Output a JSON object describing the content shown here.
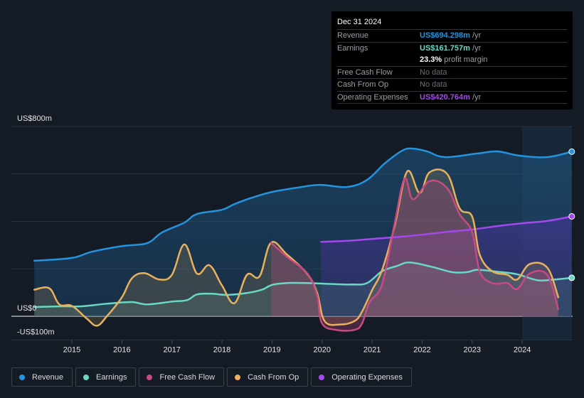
{
  "tooltip": {
    "date": "Dec 31 2024",
    "rows": [
      {
        "label": "Revenue",
        "value": "US$694.298m",
        "unit": "/yr",
        "color": "#2394df"
      },
      {
        "label": "Earnings",
        "value": "US$161.757m",
        "unit": "/yr",
        "color": "#6ad8c5"
      },
      {
        "label": "",
        "value": "23.3%",
        "unit": "profit margin",
        "color": "#ffffff"
      },
      {
        "label": "Free Cash Flow",
        "value": "No data",
        "unit": "",
        "color": "#6b7075"
      },
      {
        "label": "Cash From Op",
        "value": "No data",
        "unit": "",
        "color": "#6b7075"
      },
      {
        "label": "Operating Expenses",
        "value": "US$420.764m",
        "unit": "/yr",
        "color": "#a548ef"
      }
    ]
  },
  "legend": [
    {
      "label": "Revenue",
      "color": "#2394df"
    },
    {
      "label": "Earnings",
      "color": "#6ad8c5"
    },
    {
      "label": "Free Cash Flow",
      "color": "#c94a83"
    },
    {
      "label": "Cash From Op",
      "color": "#e9b15c"
    },
    {
      "label": "Operating Expenses",
      "color": "#a548ef"
    }
  ],
  "chart_data": {
    "type": "area",
    "title": "",
    "xlabel": "",
    "ylabel": "",
    "ylim": [
      -100,
      800
    ],
    "xlim": [
      2014.25,
      2024.99
    ],
    "y_tick_labels": [
      {
        "value": 800,
        "label": "US$800m"
      },
      {
        "value": 0,
        "label": "US$0"
      },
      {
        "value": -100,
        "label": "-US$100m"
      }
    ],
    "gridlines_y": [
      800,
      600,
      400,
      200,
      0,
      -100
    ],
    "x_ticks": [
      2015,
      2016,
      2017,
      2018,
      2019,
      2020,
      2021,
      2022,
      2023,
      2024
    ],
    "highlight_region": {
      "from": 2024.0,
      "to": 2024.99
    },
    "grid": true,
    "legend_position": "bottom-left",
    "series": [
      {
        "name": "Revenue",
        "color": "#2394df",
        "points": [
          [
            2014.25,
            234
          ],
          [
            2015.0,
            246
          ],
          [
            2015.4,
            272
          ],
          [
            2016.0,
            296
          ],
          [
            2016.5,
            308
          ],
          [
            2016.8,
            353
          ],
          [
            2017.25,
            395
          ],
          [
            2017.5,
            431
          ],
          [
            2018.0,
            449
          ],
          [
            2018.25,
            473
          ],
          [
            2018.6,
            500
          ],
          [
            2019.0,
            524
          ],
          [
            2019.5,
            542
          ],
          [
            2019.95,
            554
          ],
          [
            2020.5,
            545
          ],
          [
            2020.9,
            575
          ],
          [
            2021.25,
            644
          ],
          [
            2021.6,
            698
          ],
          [
            2021.8,
            707
          ],
          [
            2022.1,
            695
          ],
          [
            2022.45,
            671
          ],
          [
            2023.1,
            686
          ],
          [
            2023.5,
            695
          ],
          [
            2023.95,
            677
          ],
          [
            2024.5,
            671
          ],
          [
            2024.99,
            694
          ]
        ]
      },
      {
        "name": "Operating Expenses",
        "color": "#a548ef",
        "points": [
          [
            2019.98,
            314
          ],
          [
            2020.5,
            318
          ],
          [
            2021.0,
            326
          ],
          [
            2021.5,
            334
          ],
          [
            2022.0,
            344
          ],
          [
            2022.5,
            356
          ],
          [
            2023.0,
            366
          ],
          [
            2023.5,
            380
          ],
          [
            2024.0,
            392
          ],
          [
            2024.5,
            402
          ],
          [
            2024.99,
            421
          ]
        ]
      },
      {
        "name": "Earnings",
        "color": "#6ad8c5",
        "points": [
          [
            2014.25,
            39
          ],
          [
            2014.8,
            42
          ],
          [
            2015.2,
            42
          ],
          [
            2015.7,
            53
          ],
          [
            2016.2,
            60
          ],
          [
            2016.5,
            50
          ],
          [
            2017.0,
            62
          ],
          [
            2017.3,
            68
          ],
          [
            2017.5,
            92
          ],
          [
            2017.8,
            95
          ],
          [
            2018.1,
            90
          ],
          [
            2018.5,
            98
          ],
          [
            2018.8,
            112
          ],
          [
            2019.0,
            132
          ],
          [
            2019.3,
            140
          ],
          [
            2019.7,
            140
          ],
          [
            2020.2,
            136
          ],
          [
            2020.6,
            134
          ],
          [
            2020.9,
            140
          ],
          [
            2021.2,
            190
          ],
          [
            2021.5,
            212
          ],
          [
            2021.75,
            227
          ],
          [
            2022.2,
            208
          ],
          [
            2022.6,
            186
          ],
          [
            2022.9,
            186
          ],
          [
            2023.1,
            196
          ],
          [
            2023.5,
            188
          ],
          [
            2023.9,
            177
          ],
          [
            2024.3,
            152
          ],
          [
            2024.6,
            154
          ],
          [
            2024.99,
            162
          ]
        ]
      },
      {
        "name": "Free Cash Flow",
        "color": "#c94a83",
        "points": [
          [
            2018.98,
            310
          ],
          [
            2019.3,
            250
          ],
          [
            2019.7,
            182
          ],
          [
            2019.9,
            90
          ],
          [
            2020.0,
            -30
          ],
          [
            2020.3,
            -58
          ],
          [
            2020.65,
            -57
          ],
          [
            2020.8,
            -30
          ],
          [
            2020.95,
            60
          ],
          [
            2021.2,
            135
          ],
          [
            2021.45,
            390
          ],
          [
            2021.65,
            580
          ],
          [
            2021.82,
            493
          ],
          [
            2022.15,
            570
          ],
          [
            2022.5,
            540
          ],
          [
            2022.75,
            430
          ],
          [
            2023.0,
            355
          ],
          [
            2023.15,
            190
          ],
          [
            2023.4,
            140
          ],
          [
            2023.7,
            140
          ],
          [
            2023.9,
            115
          ],
          [
            2024.15,
            180
          ],
          [
            2024.5,
            175
          ],
          [
            2024.72,
            30
          ]
        ]
      },
      {
        "name": "Cash From Op",
        "color": "#e9b15c",
        "points": [
          [
            2014.25,
            112
          ],
          [
            2014.55,
            118
          ],
          [
            2014.75,
            50
          ],
          [
            2015.0,
            44
          ],
          [
            2015.3,
            -10
          ],
          [
            2015.5,
            -40
          ],
          [
            2015.7,
            0
          ],
          [
            2016.0,
            80
          ],
          [
            2016.2,
            160
          ],
          [
            2016.45,
            182
          ],
          [
            2016.75,
            155
          ],
          [
            2017.0,
            175
          ],
          [
            2017.25,
            303
          ],
          [
            2017.5,
            180
          ],
          [
            2017.75,
            215
          ],
          [
            2018.0,
            130
          ],
          [
            2018.25,
            55
          ],
          [
            2018.5,
            175
          ],
          [
            2018.75,
            168
          ],
          [
            2018.98,
            310
          ],
          [
            2019.3,
            260
          ],
          [
            2019.7,
            180
          ],
          [
            2019.9,
            100
          ],
          [
            2020.05,
            -20
          ],
          [
            2020.35,
            -35
          ],
          [
            2020.65,
            -20
          ],
          [
            2020.8,
            20
          ],
          [
            2021.0,
            110
          ],
          [
            2021.2,
            195
          ],
          [
            2021.45,
            380
          ],
          [
            2021.7,
            610
          ],
          [
            2021.95,
            520
          ],
          [
            2022.15,
            607
          ],
          [
            2022.5,
            600
          ],
          [
            2022.75,
            455
          ],
          [
            2023.0,
            420
          ],
          [
            2023.15,
            260
          ],
          [
            2023.4,
            190
          ],
          [
            2023.7,
            175
          ],
          [
            2023.9,
            155
          ],
          [
            2024.15,
            220
          ],
          [
            2024.5,
            205
          ],
          [
            2024.72,
            80
          ]
        ]
      }
    ]
  }
}
